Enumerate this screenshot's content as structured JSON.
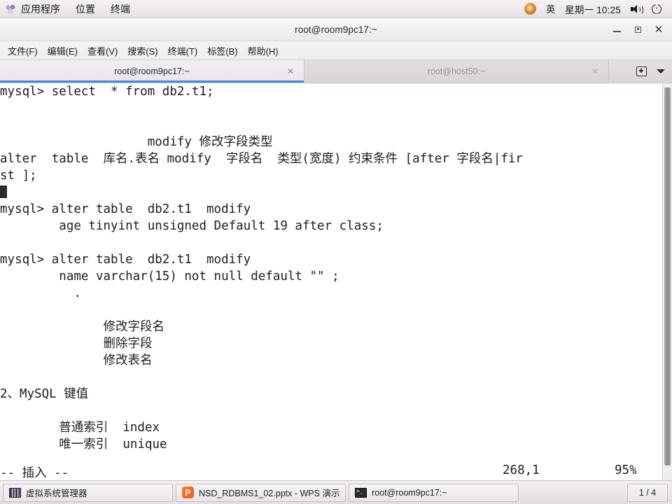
{
  "panel": {
    "logo_icon": "fedora-logo-icon",
    "menus": [
      "应用程序",
      "位置",
      "终端"
    ],
    "tray": {
      "input_method_icon": "fcitx-input-method-icon",
      "input_method_label": "英",
      "clock": "星期一 10:25",
      "volume_icon": "speaker-icon",
      "power_icon": "power-icon"
    }
  },
  "window": {
    "title": "root@room9pc17:~",
    "minimize_label": "_",
    "maximize_label": "□",
    "close_label": "✕",
    "menubar": [
      "文件(F)",
      "编辑(E)",
      "查看(V)",
      "搜索(S)",
      "终端(T)",
      "标签(B)",
      "帮助(H)"
    ]
  },
  "tabs": {
    "items": [
      {
        "label": "root@room9pc17:~",
        "active": true,
        "close_label": "✕"
      },
      {
        "label": "root@host50:~",
        "active": false,
        "close_label": "✕"
      }
    ],
    "new_tab_icon": "new-tab-icon",
    "dropdown_icon": "chevron-down-icon"
  },
  "terminal": {
    "lines": [
      "mysql> select  * from db2.t1;",
      "",
      "",
      "                    modify 修改字段类型",
      "alter  table  库名.表名 modify  字段名  类型(宽度) 约束条件 [after 字段名|fir",
      "st ];",
      "__CURSOR__",
      "mysql> alter table  db2.t1  modify",
      "        age tinyint unsigned Default 19 after class;",
      "",
      "mysql> alter table  db2.t1  modify",
      "        name varchar(15) not null default \"\" ;",
      "          .",
      "",
      "              修改字段名",
      "              删除字段",
      "              修改表名",
      "",
      "2、MySQL 键值",
      "",
      "        普通索引  index",
      "        唯一索引  unique"
    ],
    "status": {
      "mode": "-- 插入 --",
      "ruler": "268,1",
      "percent": "95%"
    },
    "scrollbar_name": "terminal-scrollbar"
  },
  "taskbar": {
    "buttons": [
      {
        "label": "虚拟系统管理器",
        "icon": "virtual-machine-manager-icon"
      },
      {
        "label": "NSD_RDBMS1_02.pptx - WPS 演示",
        "icon": "wps-presentation-icon"
      },
      {
        "label": "root@room9pc17:~",
        "icon": "terminal-icon"
      }
    ],
    "workspace": "1 / 4"
  }
}
